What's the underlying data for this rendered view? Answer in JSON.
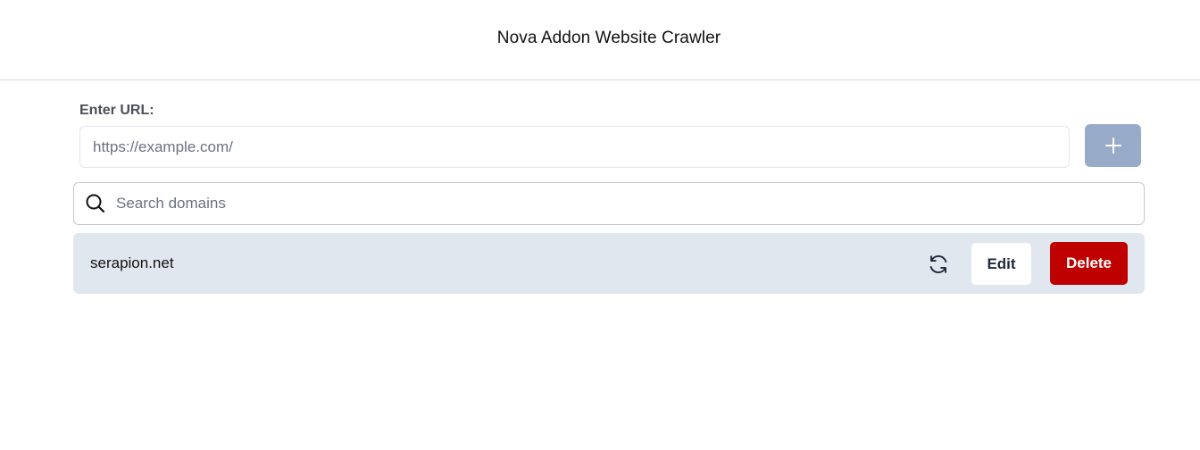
{
  "header": {
    "title": "Nova Addon Website Crawler"
  },
  "url_form": {
    "label": "Enter URL:",
    "placeholder": "https://example.com/",
    "value": "",
    "add_button_icon": "plus-icon"
  },
  "search": {
    "placeholder": "Search domains",
    "value": "",
    "icon": "search-icon"
  },
  "domains": [
    {
      "name": "serapion.net",
      "refresh_icon": "refresh-icon",
      "edit_label": "Edit",
      "delete_label": "Delete"
    }
  ],
  "colors": {
    "add_button_bg": "#97abc9",
    "row_bg": "#e1e7ef",
    "delete_bg": "#bf0000",
    "edit_bg": "#ffffff"
  }
}
